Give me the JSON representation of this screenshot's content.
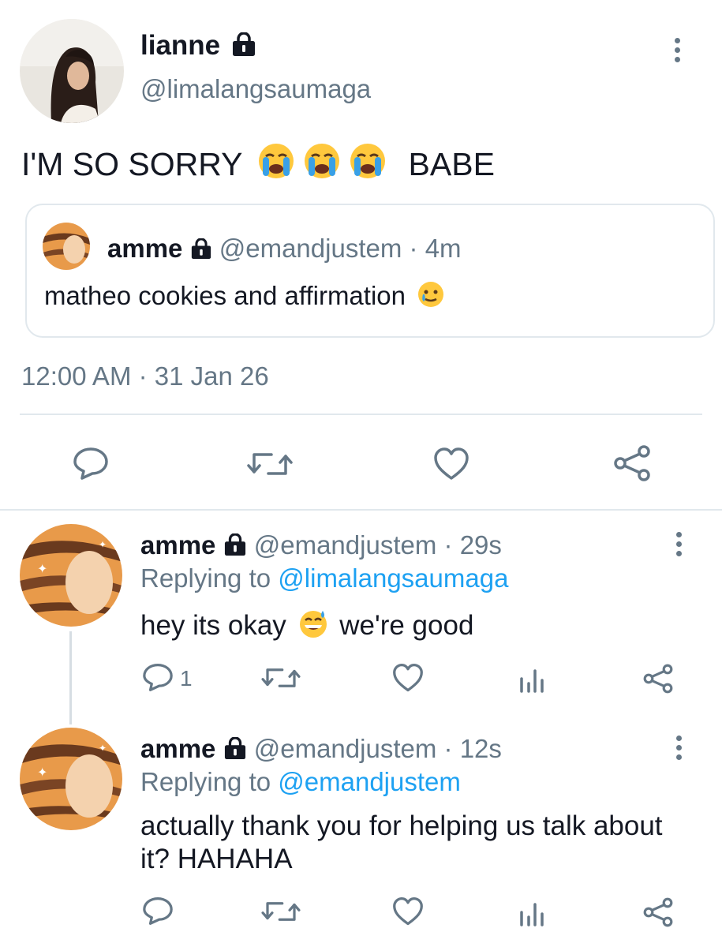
{
  "main_tweet": {
    "name": "lianne",
    "handle": "@limalangsaumaga",
    "text_before": "I'M SO SORRY",
    "emoji": "loudly-crying-face",
    "emoji_count": 3,
    "text_after": "BABE",
    "quoted": {
      "name": "amme",
      "handle": "@emandjustem",
      "sep": "·",
      "time": "4m",
      "text": "matheo cookies and affirmation",
      "emoji": "face-holding-back-tears"
    },
    "time": "12:00 AM",
    "sep": "·",
    "date": "31 Jan 26"
  },
  "replies": [
    {
      "name": "amme",
      "handle": "@emandjustem",
      "sep": "·",
      "time": "29s",
      "replying_prefix": "Replying to",
      "replying_handle": "@limalangsaumaga",
      "text_before": "hey its okay",
      "emoji": "grinning-face-with-sweat",
      "text_after": "we're good",
      "reply_count": "1"
    },
    {
      "name": "amme",
      "handle": "@emandjustem",
      "sep": "·",
      "time": "12s",
      "replying_prefix": "Replying to",
      "replying_handle": "@emandjustem",
      "text_line1": "actually thank you for helping us talk about",
      "text_line2": "it? HAHAHA",
      "reply_count": ""
    }
  ],
  "colors": {
    "text": "#141823",
    "muted": "#657786",
    "link": "#1da1f2",
    "border": "#e1e8ed"
  }
}
